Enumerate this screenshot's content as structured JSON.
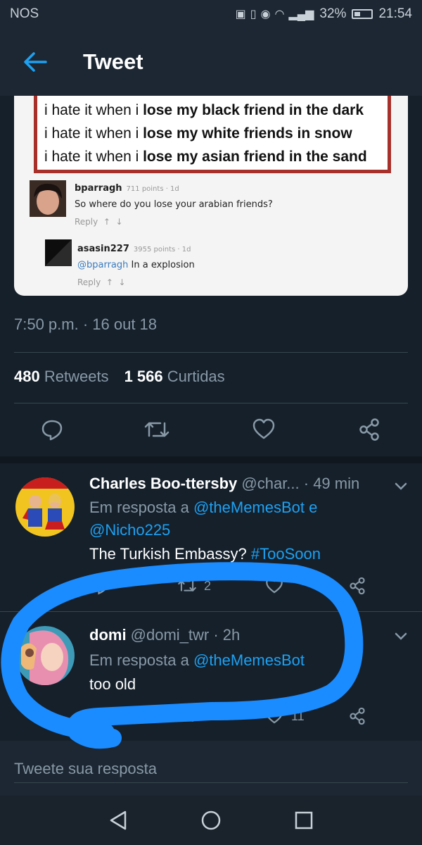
{
  "status_bar": {
    "carrier": "NOS",
    "battery": "32%",
    "time": "21:54"
  },
  "app_bar": {
    "title": "Tweet"
  },
  "meme": {
    "quote_lines": [
      {
        "plain": "i hate it when i ",
        "bold": "lose my black friend in the dark"
      },
      {
        "plain": "i hate it when i ",
        "bold": "lose my white friends in snow"
      },
      {
        "plain": "i hate it when i ",
        "bold": "lose my asian friend in the sand"
      }
    ],
    "comment1": {
      "user": "bparragh",
      "meta": "711 points · 1d",
      "text": "So where do you lose your arabian friends?",
      "reply": "Reply"
    },
    "comment2": {
      "user": "asasin227",
      "meta": "3955 points · 1d",
      "mention": "@bparragh",
      "text": " In a explosion",
      "reply": "Reply"
    }
  },
  "tweet": {
    "timestamp": "7:50 p.m. · 16 out 18",
    "retweets_count": "480",
    "retweets_label": "Retweets",
    "likes_count": "1 566",
    "likes_label": "Curtidas"
  },
  "replies": [
    {
      "name": "Charles Boo-ttersby",
      "handle_time": " @char... · 49 min",
      "in_reply_prefix": "Em resposta a ",
      "mention1": "@theMemesBot",
      "connector": " e",
      "mention2": "@Nicho225",
      "text": "The Turkish Embassy? ",
      "hashtag": "#TooSoon",
      "retweet_count": "2"
    },
    {
      "name": "domi",
      "handle_time": " @domi_twr · 2h",
      "in_reply_prefix": "Em resposta a ",
      "mention1": "@theMemesBot",
      "text": "too old",
      "like_count": "11"
    }
  ],
  "compose": {
    "placeholder": "Tweete sua resposta"
  },
  "colors": {
    "background": "#15202b",
    "accent": "#1da1f2",
    "muted": "#8899a6",
    "highlight_stroke": "#1a8cff"
  },
  "icons": [
    "back-arrow-icon",
    "reply-icon",
    "retweet-icon",
    "like-icon",
    "share-icon",
    "chevron-down-icon",
    "nav-back-icon",
    "nav-home-icon",
    "nav-recents-icon"
  ]
}
